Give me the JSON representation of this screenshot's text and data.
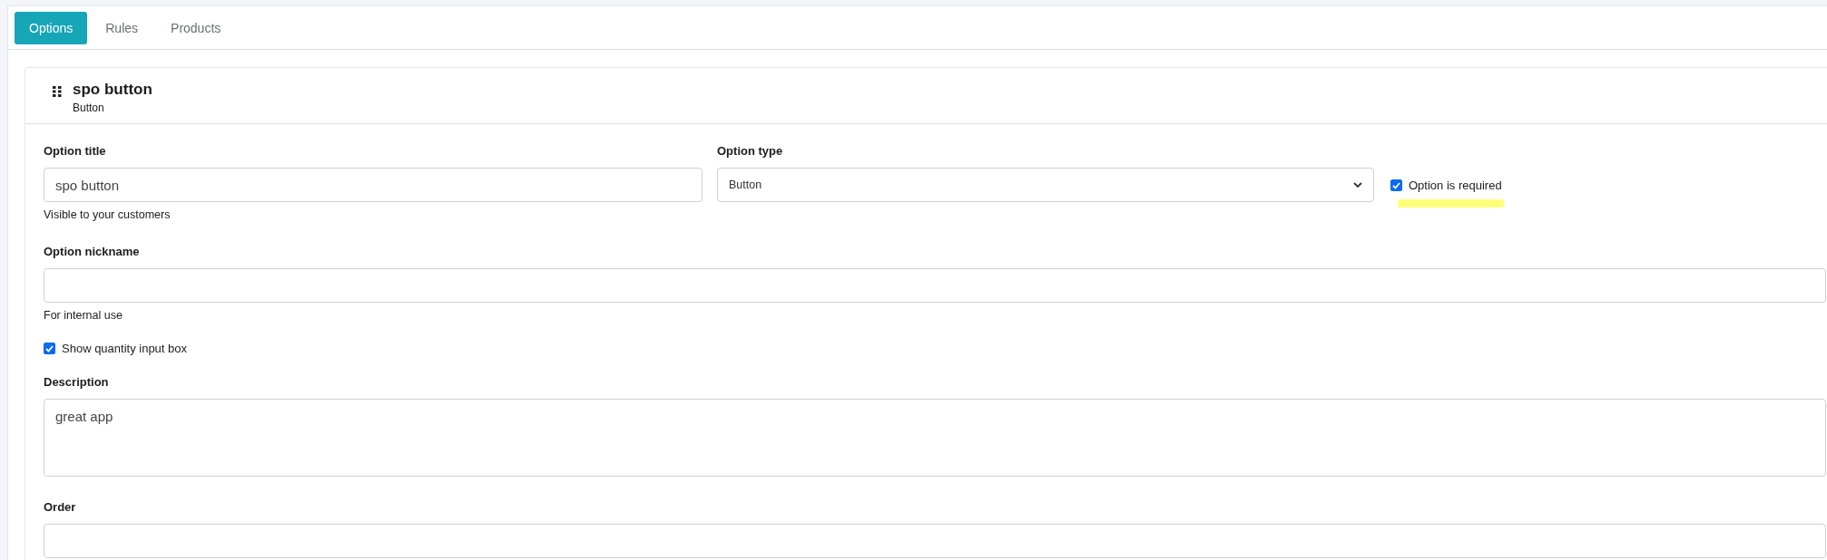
{
  "tabs": [
    {
      "label": "Options",
      "selected": true
    },
    {
      "label": "Rules",
      "selected": false
    },
    {
      "label": "Products",
      "selected": false
    }
  ],
  "card": {
    "title": "spo button",
    "subtitle": "Button"
  },
  "form": {
    "option_title": {
      "label": "Option title",
      "value": "spo button",
      "help": "Visible to your customers"
    },
    "option_type": {
      "label": "Option type",
      "value": "Button"
    },
    "required": {
      "label": "Option is required",
      "checked": true
    },
    "option_nickname": {
      "label": "Option nickname",
      "help": "For internal use"
    },
    "show_quantity": {
      "label": "Show quantity input box",
      "checked": true
    },
    "description": {
      "label": "Description",
      "value": "great app"
    },
    "order": {
      "label": "Order"
    }
  }
}
